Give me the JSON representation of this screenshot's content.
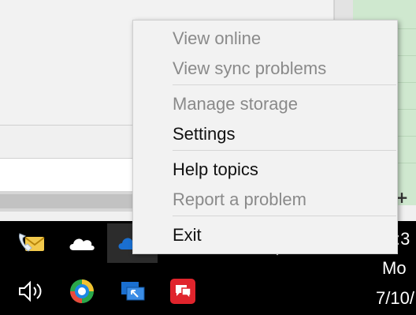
{
  "menu": {
    "items": [
      {
        "label": "View online",
        "enabled": false
      },
      {
        "label": "View sync problems",
        "enabled": false
      },
      {
        "label": "Manage storage",
        "enabled": false
      },
      {
        "label": "Settings",
        "enabled": true
      },
      {
        "label": "Help topics",
        "enabled": true
      },
      {
        "label": "Report a problem",
        "enabled": false
      },
      {
        "label": "Exit",
        "enabled": true
      }
    ]
  },
  "background": {
    "plus_glyph": "+"
  },
  "taskbar": {
    "clock": {
      "time": ":3",
      "day": "Mo",
      "date": "7/10/"
    },
    "icons": [
      {
        "name": "phone-mail-icon"
      },
      {
        "name": "onedrive-cloud-icon"
      },
      {
        "name": "onedrive-business-icon"
      },
      {
        "name": "pen-icon"
      },
      {
        "name": "touch-keyboard-icon"
      },
      {
        "name": "volume-icon"
      },
      {
        "name": "sync-circle-icon"
      },
      {
        "name": "remote-desktop-icon"
      },
      {
        "name": "chat-app-icon"
      }
    ]
  },
  "colors": {
    "menu_background": "#f2f2f2",
    "menu_text": "#111111",
    "menu_disabled_text": "#8a8a8a",
    "taskbar": "#000000",
    "onedrive_blue": "#1a6fd0",
    "chat_red": "#e0242c"
  }
}
